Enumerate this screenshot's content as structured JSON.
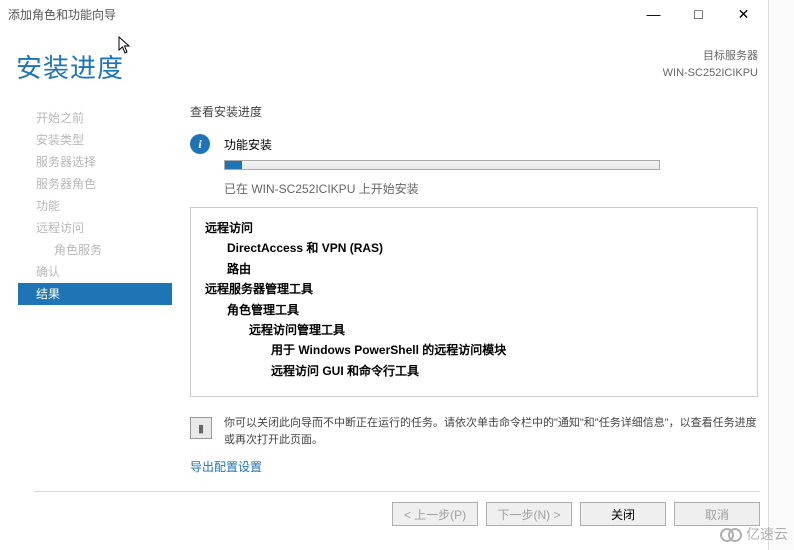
{
  "window": {
    "title": "添加角色和功能向导",
    "controls": {
      "minimize": "—",
      "maximize": "□",
      "close": "✕"
    }
  },
  "header": {
    "page_title": "安装进度",
    "target_label": "目标服务器",
    "target_name": "WIN-SC252ICIKPU"
  },
  "sidebar": {
    "items": [
      {
        "label": "开始之前"
      },
      {
        "label": "安装类型"
      },
      {
        "label": "服务器选择"
      },
      {
        "label": "服务器角色"
      },
      {
        "label": "功能"
      },
      {
        "label": "远程访问"
      },
      {
        "label": "角色服务",
        "indent": true
      },
      {
        "label": "确认"
      },
      {
        "label": "结果",
        "active": true
      }
    ]
  },
  "content": {
    "view_label": "查看安装进度",
    "status_label": "功能安装",
    "sub_status": "已在 WIN-SC252ICIKPU 上开始安装",
    "progress_percent": 4,
    "details": {
      "l0a": "远程访问",
      "l1a": "DirectAccess 和 VPN (RAS)",
      "l1b": "路由",
      "l0b": "远程服务器管理工具",
      "l1c": "角色管理工具",
      "l2a": "远程访问管理工具",
      "l3a": "用于 Windows PowerShell 的远程访问模块",
      "l3b": "远程访问 GUI 和命令行工具"
    },
    "note": "你可以关闭此向导而不中断正在运行的任务。请依次单击命令栏中的\"通知\"和\"任务详细信息\"，以查看任务进度或再次打开此页面。",
    "export_link": "导出配置设置"
  },
  "footer": {
    "prev": "< 上一步(P)",
    "next": "下一步(N) >",
    "close": "关闭",
    "cancel": "取消"
  },
  "watermark": "亿速云"
}
